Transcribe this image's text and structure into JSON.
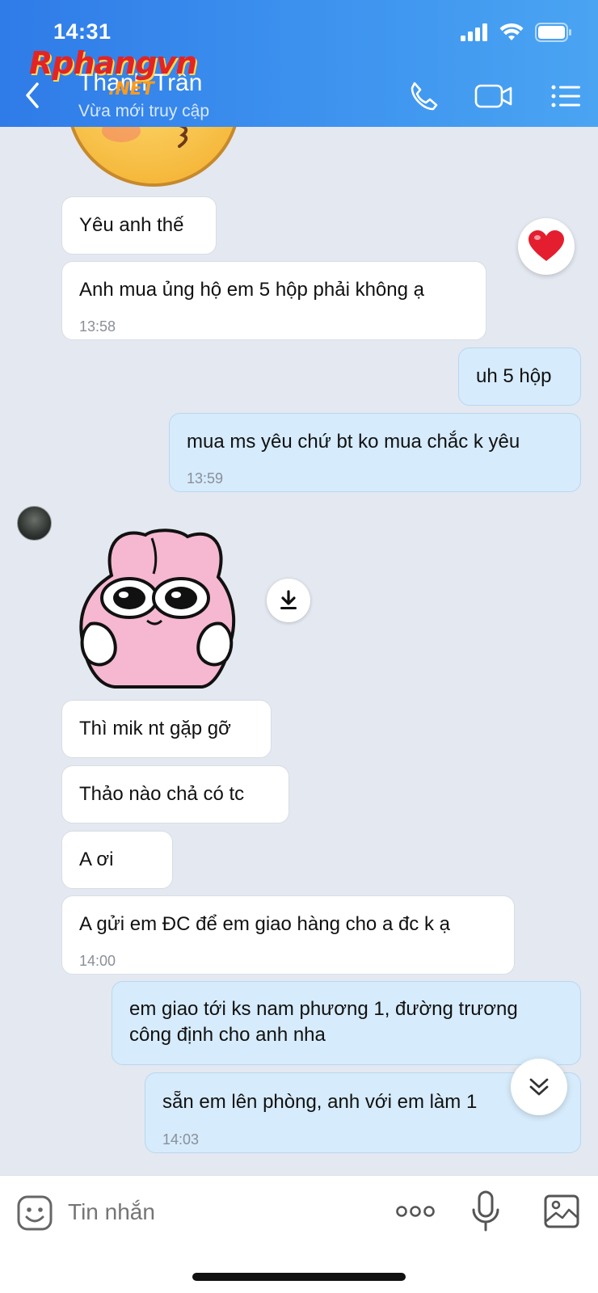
{
  "status_bar": {
    "time": "14:31"
  },
  "header": {
    "contact_name": "Thanh Trần",
    "contact_status": "Vừa mới truy cập",
    "watermark": "Rphangvn",
    "watermark_suffix": ".NET"
  },
  "messages": [
    {
      "dir": "in",
      "text": "Yêu anh thế",
      "time": ""
    },
    {
      "dir": "in",
      "text": "Anh mua ủng hộ em 5 hộp phải không ạ",
      "time": "13:58"
    },
    {
      "dir": "out",
      "text": "uh 5 hộp",
      "time": ""
    },
    {
      "dir": "out",
      "text": "mua ms yêu chứ bt ko mua chắc k yêu",
      "time": "13:59"
    },
    {
      "dir": "in",
      "text": "Thì mik nt gặp gỡ",
      "time": ""
    },
    {
      "dir": "in",
      "text": "Thảo nào chả có tc",
      "time": ""
    },
    {
      "dir": "in",
      "text": "A ơi",
      "time": ""
    },
    {
      "dir": "in",
      "text": "A gửi em ĐC để em giao hàng cho a đc k ạ",
      "time": "14:00"
    },
    {
      "dir": "out",
      "text_lines": [
        "em giao tới ks nam phương 1, đường trương",
        "công định cho anh nha"
      ],
      "time": ""
    },
    {
      "dir": "out",
      "text": "sẵn em lên phòng, anh với em làm 1",
      "time": "14:03"
    }
  ],
  "reaction": {
    "icon": "heart-icon"
  },
  "input": {
    "placeholder": "Tin nhắn"
  },
  "colors": {
    "header": "#3a8cec",
    "incoming": "#ffffff",
    "outgoing": "#d6ebfb",
    "background": "#e4e8f0"
  }
}
